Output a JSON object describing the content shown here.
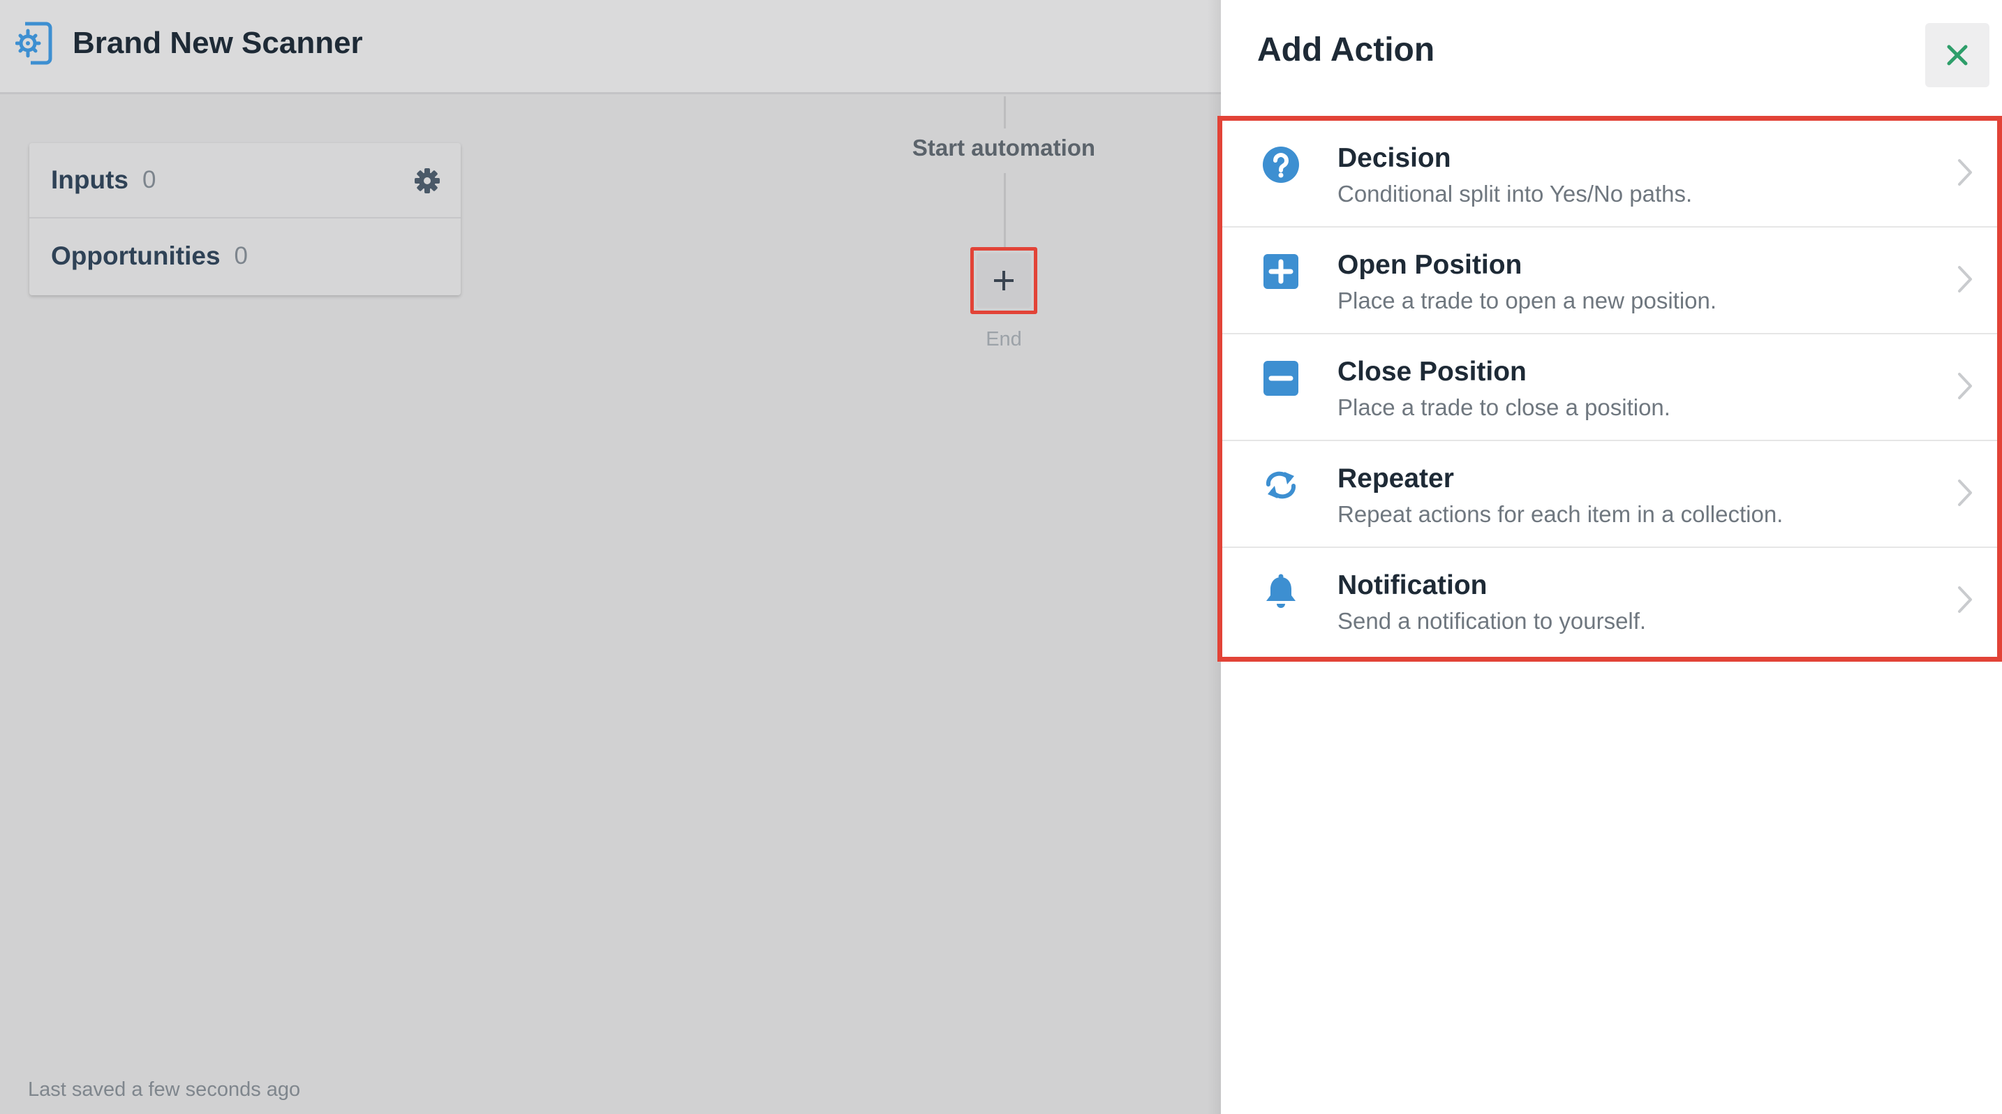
{
  "header": {
    "app_icon": "gear-document-icon",
    "title": "Brand New Scanner"
  },
  "panel": {
    "rows": [
      {
        "label": "Inputs",
        "count": "0"
      },
      {
        "label": "Opportunities",
        "count": "0"
      }
    ],
    "settings_icon": "gear-icon"
  },
  "flow": {
    "start_label": "Start automation",
    "add_icon": "plus-icon",
    "end_label": "End"
  },
  "footer": {
    "saved_text": "Last saved a few seconds ago"
  },
  "sheet": {
    "title": "Add Action",
    "close_icon": "close-icon",
    "actions": [
      {
        "icon": "question-circle-icon",
        "title": "Decision",
        "description": "Conditional split into Yes/No paths."
      },
      {
        "icon": "plus-square-icon",
        "title": "Open Position",
        "description": "Place a trade to open a new position."
      },
      {
        "icon": "minus-square-icon",
        "title": "Close Position",
        "description": "Place a trade to close a position."
      },
      {
        "icon": "repeat-icon",
        "title": "Repeater",
        "description": "Repeat actions for each item in a collection."
      },
      {
        "icon": "bell-icon",
        "title": "Notification",
        "description": "Send a notification to yourself."
      }
    ]
  },
  "colors": {
    "accent_blue": "#3d8fd1",
    "highlight_red": "#e24337",
    "close_green": "#2e9e6a",
    "text_dark": "#1e2a36"
  }
}
